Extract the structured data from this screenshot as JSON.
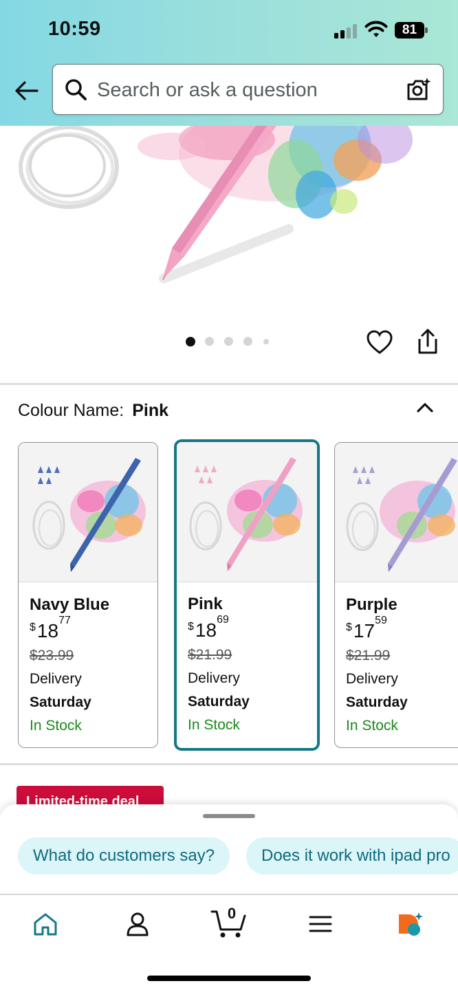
{
  "status_bar": {
    "time": "10:59",
    "battery": "81"
  },
  "search": {
    "placeholder": "Search or ask a question"
  },
  "colour": {
    "label": "Colour Name:",
    "selected": "Pink"
  },
  "swatches": [
    {
      "name": "Navy Blue",
      "price_currency": "$",
      "price_whole": "18",
      "price_fraction": "77",
      "list_price": "$23.99",
      "delivery": "Delivery",
      "day": "Saturday",
      "stock": "In Stock",
      "color": "#3e63ad"
    },
    {
      "name": "Pink",
      "price_currency": "$",
      "price_whole": "18",
      "price_fraction": "69",
      "list_price": "$21.99",
      "delivery": "Delivery",
      "day": "Saturday",
      "stock": "In Stock",
      "color": "#f0a0c4"
    },
    {
      "name": "Purple",
      "price_currency": "$",
      "price_whole": "17",
      "price_fraction": "59",
      "list_price": "$21.99",
      "delivery": "Delivery",
      "day": "Saturday",
      "stock": "In Stock",
      "color": "#a79bd2"
    }
  ],
  "deal": {
    "label": "Limited-time deal"
  },
  "suggestions": [
    "What do customers say?",
    "Does it work with ipad pro"
  ],
  "cart": {
    "count": "0"
  },
  "colors": {
    "accent": "#147786",
    "deal_red": "#cc0c39",
    "stock_green": "#1a8a1a",
    "chip_bg": "#dcf5f8"
  }
}
